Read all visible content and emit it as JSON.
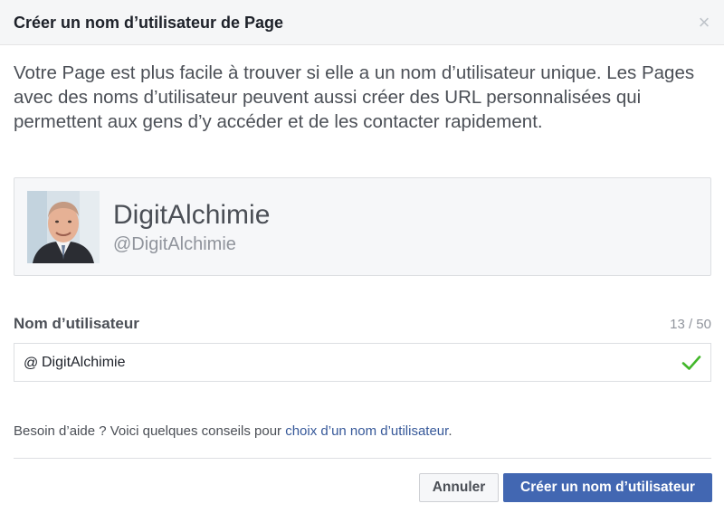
{
  "dialog": {
    "title": "Créer un nom d’utilisateur de Page",
    "close_symbol": "×",
    "intro": "Votre Page est plus facile à trouver si elle a un nom d’utilisateur unique. Les Pages avec des noms d’utilisateur peuvent aussi créer des URL personnalisées qui permettent aux gens d’y accéder et de les contacter rapidement."
  },
  "preview": {
    "page_name": "DigitAlchimie",
    "handle": "@DigitAlchimie"
  },
  "username_field": {
    "label": "Nom d’utilisateur",
    "counter": "13 / 50",
    "prefix": "@",
    "value": "DigitAlchimie",
    "status_icon": "check-icon",
    "status_color": "#42b72a"
  },
  "help": {
    "text": "Besoin d’aide ? Voici quelques conseils pour ",
    "link": "choix d’un nom d’utilisateur",
    "suffix": "."
  },
  "buttons": {
    "cancel": "Annuler",
    "create": "Créer un nom d’utilisateur"
  },
  "colors": {
    "primary": "#4267b2",
    "link": "#365899",
    "header_bg": "#f5f6f7"
  }
}
